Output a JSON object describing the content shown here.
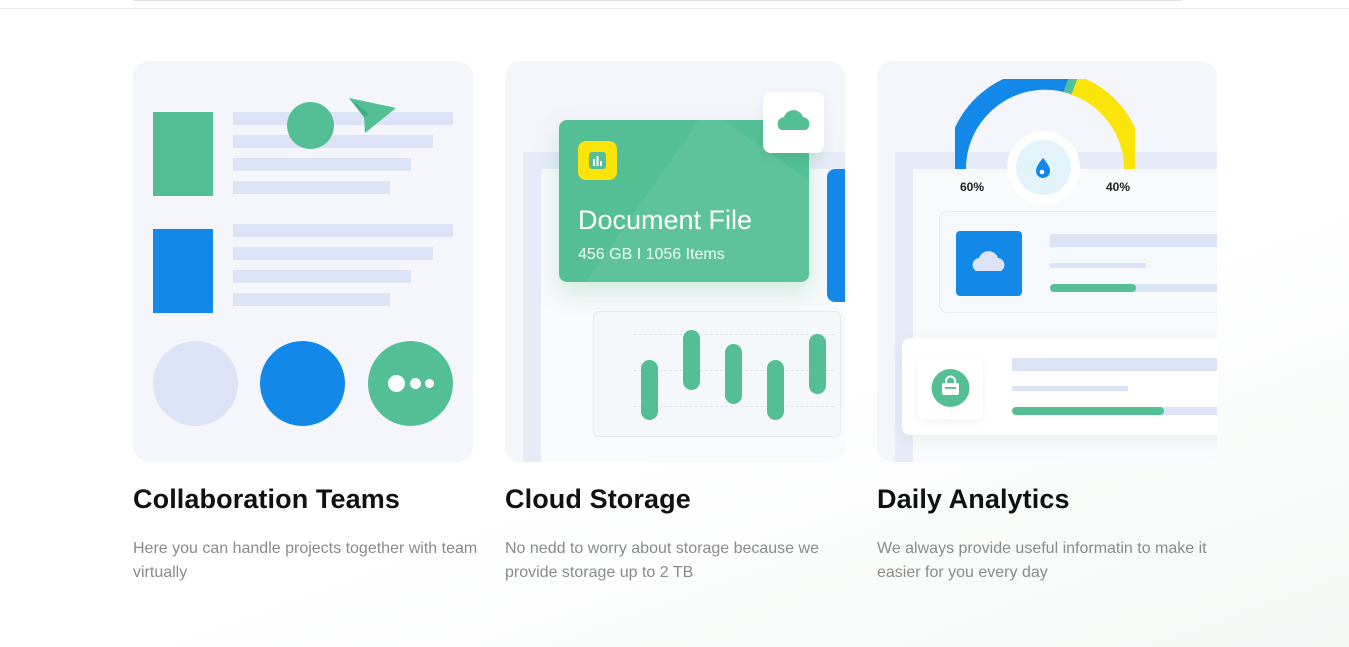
{
  "colors": {
    "green": "#54bf94",
    "blue": "#1289e8",
    "yellow": "#fbe40a",
    "light_bar": "#dce3f7",
    "card_bg": "#f5f5fc"
  },
  "cards": [
    {
      "title": "Collaboration Teams",
      "description": "Here you can handle projects together with team virtually",
      "icons": [
        "send-icon",
        "more-dots-icon"
      ]
    },
    {
      "title": "Cloud Storage",
      "description": "No nedd to worry about storage because we provide storage up to 2 TB",
      "file_card": {
        "title": "Document File",
        "subtitle": "456 GB I 1056 Items"
      },
      "icons": [
        "bar-chart-icon",
        "cloud-icon"
      ]
    },
    {
      "title": "Daily Analytics",
      "description": "We always provide useful informatin to make it easier for you every day",
      "gauge": {
        "left_label": "60%",
        "right_label": "40%",
        "left_percent": 60,
        "right_percent": 40
      },
      "progress": [
        0.32,
        0.6
      ],
      "icons": [
        "drop-icon",
        "cloud-icon",
        "shopping-bag-icon"
      ]
    }
  ]
}
